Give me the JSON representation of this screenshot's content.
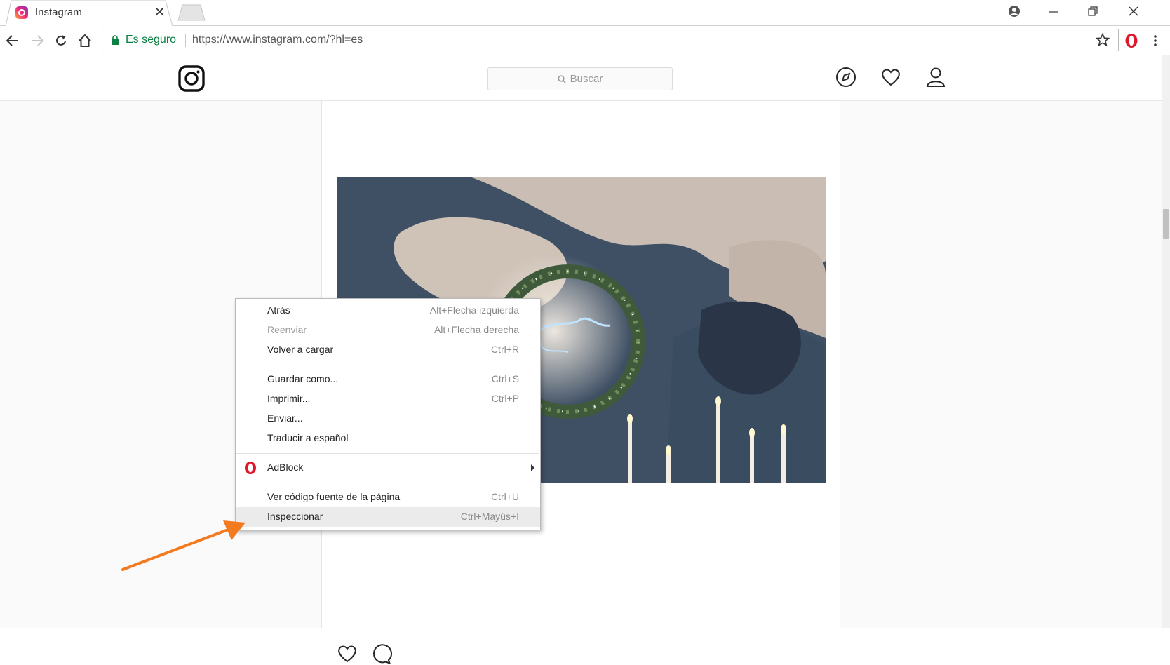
{
  "browser": {
    "tab_title": "Instagram",
    "security_label": "Es seguro",
    "url": "https://www.instagram.com/?hl=es"
  },
  "instagram": {
    "search_placeholder": "Buscar"
  },
  "context_menu": {
    "items": [
      {
        "label": "Atrás",
        "shortcut": "Alt+Flecha izquierda",
        "enabled": true
      },
      {
        "label": "Reenviar",
        "shortcut": "Alt+Flecha derecha",
        "enabled": false
      },
      {
        "label": "Volver a cargar",
        "shortcut": "Ctrl+R",
        "enabled": true
      },
      {
        "label": "Guardar como...",
        "shortcut": "Ctrl+S",
        "enabled": true
      },
      {
        "label": "Imprimir...",
        "shortcut": "Ctrl+P",
        "enabled": true
      },
      {
        "label": "Enviar...",
        "shortcut": "",
        "enabled": true
      },
      {
        "label": "Traducir a español",
        "shortcut": "",
        "enabled": true
      },
      {
        "label": "AdBlock",
        "shortcut": "",
        "enabled": true,
        "has_submenu": true
      },
      {
        "label": "Ver código fuente de la página",
        "shortcut": "Ctrl+U",
        "enabled": true
      },
      {
        "label": "Inspeccionar",
        "shortcut": "Ctrl+Mayús+I",
        "enabled": true,
        "highlighted": true
      }
    ]
  },
  "colors": {
    "annotation_arrow": "#f47a20",
    "secure_green": "#0b8043",
    "opera_red": "#e0162b"
  },
  "icons": {
    "back": "arrow-left-icon",
    "forward": "arrow-right-icon",
    "reload": "reload-icon",
    "home": "home-icon",
    "explore": "compass-icon",
    "activity": "heart-icon",
    "profile": "person-icon"
  }
}
